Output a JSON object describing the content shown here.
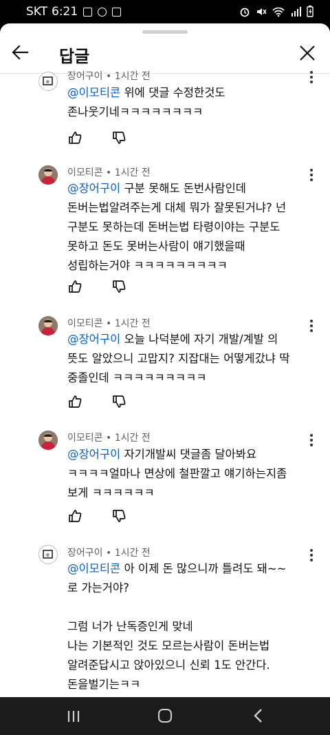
{
  "status_bar": {
    "carrier": "SKT",
    "time": "6:21"
  },
  "header": {
    "title": "답글"
  },
  "comments": [
    {
      "author": "장어구이",
      "time": "1시간 전",
      "mention": "@이모티콘",
      "text": " 위에 댓글 수정한것도\n존나웃기네ㅋㅋㅋㅋㅋㅋㅋㅋ",
      "avatar": "logo-avatar"
    },
    {
      "author": "이모티콘",
      "time": "1시간 전",
      "mention": "@장어구이",
      "text": " 구분 못해도 돈번사람인데\n돈버는법알려주는게 대체 뭐가 잘못된거냐? 넌\n구분도 못하는데 돈버는법 타령이야는 구분도\n못하고 돈도 못버는사람이 얘기했을때\n성립하는거야 ㅋㅋㅋㅋㅋㅋㅋㅋㅋ",
      "avatar": "photo-avatar"
    },
    {
      "author": "이모티콘",
      "time": "1시간 전",
      "mention": "@장어구이",
      "text": " 오늘 나덕분에 자기 개발/계발 의\n뜻도 알았으니 고맙지? 지잡대는 어떻게갔냐 딱\n중졸인데 ㅋㅋㅋㅋㅋㅋㅋㅋㅋ",
      "avatar": "photo-avatar"
    },
    {
      "author": "이모티콘",
      "time": "1시간 전",
      "mention": "@장어구이",
      "text": " 자기개발씨 댓글좀 달아봐요\nㅋㅋㅋㅋ얼마나 면상에 철판깔고 얘기하는지좀\n보게 ㅋㅋㅋㅋㅋㅋ",
      "avatar": "photo-avatar"
    },
    {
      "author": "장어구이",
      "time": "1시간 전",
      "mention": "@이모티콘",
      "text": " 아 이제 돈 많으니까 틀려도 돼~~\n로 가는거야?\n\n그럼 너가 난독증인게 맞네\n나는 기본적인 것도 모르는사람이 돈버는법\n알려준답시고 앉아있으니 신뢰 1도 안간다.\n돈을벌기는ㅋㅋ\n했는데 너는 무슨소리를 하는거니??",
      "avatar": "logo-avatar"
    }
  ],
  "meta_separator": " • "
}
